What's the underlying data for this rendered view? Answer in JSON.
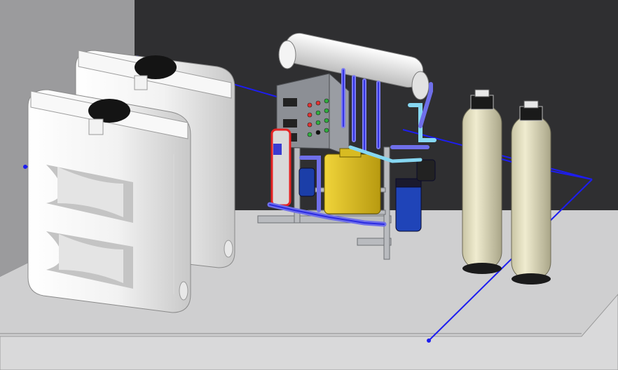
{
  "scene": {
    "colors": {
      "back_wall": "#2f2f31",
      "left_wall": "#9a9a9c",
      "floor": "#cfcfd0",
      "tank_white": "#f4f4f4",
      "tank_shadow": "#c9c9c9",
      "lid_black": "#141414",
      "pipe_blue": "#1d1df0",
      "frame_grey": "#b9bbbf",
      "control_panel": "#8c8f95",
      "yellow_tank": "#e0c21a",
      "filter_beige": "#e6e2c4",
      "red_accent": "#e62323",
      "light_blue_pipe": "#86d7f2"
    },
    "objects": [
      "storage-tank-rear",
      "storage-tank-front",
      "ro-unit",
      "control-panel",
      "membrane-housing",
      "yellow-tank",
      "media-filter-left",
      "media-filter-right",
      "blue-pipe"
    ],
    "panel_indicators": [
      "red",
      "red",
      "green",
      "red",
      "green",
      "green",
      "red",
      "green",
      "green",
      "green",
      "black",
      "green"
    ]
  }
}
